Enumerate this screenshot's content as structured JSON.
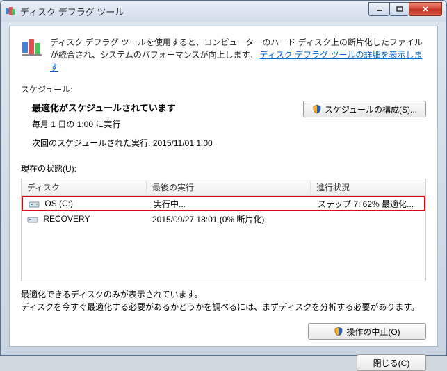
{
  "window": {
    "title": "ディスク デフラグ ツール"
  },
  "intro": {
    "text_before": "ディスク デフラグ ツールを使用すると、コンピューターのハード ディスク上の断片化したファイルが統合され、システムのパフォーマンスが向上します。",
    "link": "ディスク デフラグ ツールの詳細を表示します"
  },
  "schedule": {
    "label": "スケジュール:",
    "title": "最適化がスケジュールされています",
    "frequency": "毎月 1 日の 1:00 に実行",
    "next_run_label": "次回のスケジュールされた実行: 2015/11/01 1:00",
    "configure_button": "スケジュールの構成(S)..."
  },
  "status": {
    "label": "現在の状態(U):"
  },
  "columns": {
    "disk": "ディスク",
    "last_run": "最後の実行",
    "progress": "進行状況"
  },
  "disks": [
    {
      "name": "OS (C:)",
      "last_run": "実行中...",
      "progress": "ステップ 7: 62% 最適化...",
      "highlighted": true
    },
    {
      "name": "RECOVERY",
      "last_run": "2015/09/27 18:01 (0% 断片化)",
      "progress": "",
      "highlighted": false
    }
  ],
  "footnote": {
    "line1": "最適化できるディスクのみが表示されています。",
    "line2": "ディスクを今すぐ最適化する必要があるかどうかを調べるには、まずディスクを分析する必要があります。"
  },
  "actions": {
    "stop": "操作の中止(O)",
    "close": "閉じる(C)"
  }
}
